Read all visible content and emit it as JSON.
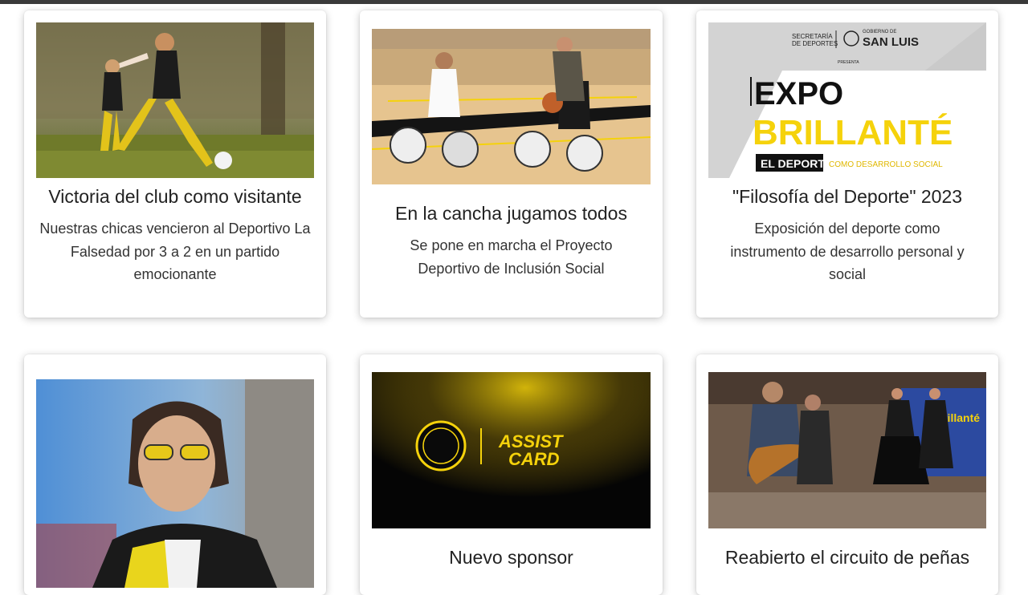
{
  "cards": [
    {
      "title": "Victoria del club como visitante",
      "description": "Nuestras chicas vencieron al Deportivo La Falsedad por 3 a 2 en un partido emocionante",
      "image_alt": "girls-soccer-photo"
    },
    {
      "title": "En la cancha jugamos todos",
      "description": "Se pone en marcha el Proyecto Deportivo de Inclusión Social",
      "image_alt": "wheelchair-basketball-photo"
    },
    {
      "title": "\"Filosofía del Deporte\" 2023",
      "description": "Exposición del deporte como instrumento de desarrollo personal y social",
      "image_alt": "expo-brillante-poster",
      "poster": {
        "secretaria": "SECRETARÍA",
        "de_deportes": "DE DEPORTES",
        "gobierno_de": "GOBIERNO DE",
        "san_luis": "SAN LUIS",
        "presenta": "PRESENTA",
        "expo": "EXPO",
        "brillante": "BRILLANTÉ",
        "el_deporte": "EL DEPORTE",
        "como_desarrollo": "COMO DESARROLLO SOCIAL"
      }
    },
    {
      "title": "",
      "description": "",
      "image_alt": "woman-sunglasses-photo"
    },
    {
      "title": "Nuevo sponsor",
      "description": "",
      "image_alt": "assist-card-sponsor-banner",
      "banner": {
        "assist": "ASSIST",
        "card": "CARD"
      }
    },
    {
      "title": "Reabierto el circuito de peñas",
      "description": "",
      "image_alt": "pena-folk-music-photo",
      "banner_text": "Brillanté"
    }
  ],
  "colors": {
    "accent_yellow": "#f5d20b",
    "top_bar": "#3a3a3a"
  }
}
